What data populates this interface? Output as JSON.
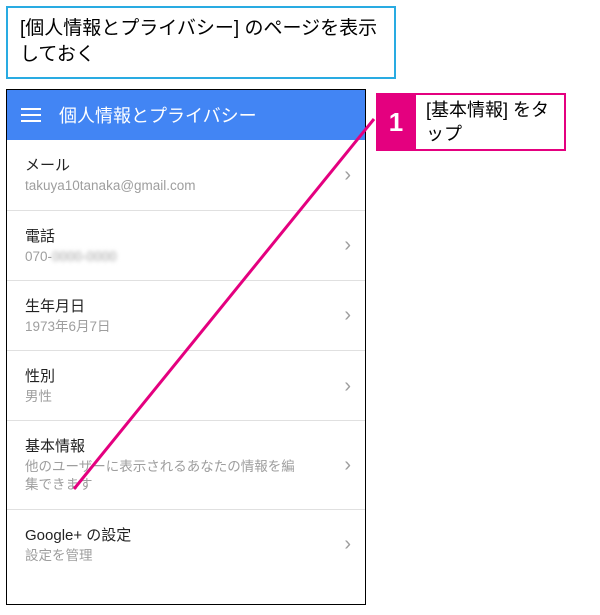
{
  "callout_top": "[個人情報とプライバシー] のページを表示しておく",
  "app_bar": {
    "title": "個人情報とプライバシー"
  },
  "rows": [
    {
      "title": "メール",
      "sub": "takuya10tanaka@gmail.com",
      "blur": false
    },
    {
      "title": "電話",
      "sub": "070-████-████",
      "blur": true
    },
    {
      "title": "生年月日",
      "sub": "1973年6月7日",
      "blur": false
    },
    {
      "title": "性別",
      "sub": "男性",
      "blur": false
    },
    {
      "title": "基本情報",
      "sub": "他のユーザーに表示されるあなたの情報を編集できます",
      "blur": false
    },
    {
      "title": "Google+ の設定",
      "sub": "設定を管理",
      "blur": false
    }
  ],
  "step": {
    "num": "1",
    "text": "[基本情報] をタップ"
  },
  "colors": {
    "accent": "#e4007f",
    "appbar": "#4285f4",
    "callout_border": "#29abe2"
  }
}
